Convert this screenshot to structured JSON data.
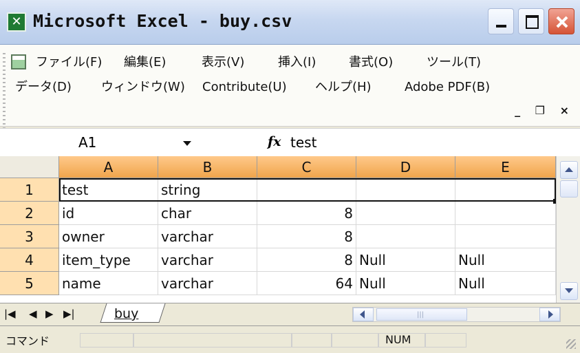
{
  "window": {
    "title": "Microsoft Excel - buy.csv",
    "app_icon_glyph": "✕"
  },
  "menu": {
    "row1": [
      "ファイル(F)",
      "編集(E)",
      "表示(V)",
      "挿入(I)",
      "書式(O)",
      "ツール(T)"
    ],
    "row2": [
      "データ(D)",
      "ウィンドウ(W)",
      "Contribute(U)",
      "ヘルプ(H)",
      "Adobe PDF(B)"
    ],
    "doc_controls": "_ ❐ ×"
  },
  "formula_bar": {
    "name_box": "A1",
    "fx_label": "fx",
    "value": "test"
  },
  "grid": {
    "columns": [
      "A",
      "B",
      "C",
      "D",
      "E"
    ],
    "rows": [
      {
        "num": "1",
        "cells": [
          "test",
          "string",
          "",
          "",
          ""
        ]
      },
      {
        "num": "2",
        "cells": [
          "id",
          "char",
          "8",
          "",
          ""
        ]
      },
      {
        "num": "3",
        "cells": [
          "owner",
          "varchar",
          "8",
          "",
          ""
        ]
      },
      {
        "num": "4",
        "cells": [
          "item_type",
          "varchar",
          "8",
          "Null",
          "Null"
        ]
      },
      {
        "num": "5",
        "cells": [
          "name",
          "varchar",
          "64",
          "Null",
          "Null"
        ]
      }
    ]
  },
  "sheets": {
    "nav": [
      "|◀",
      "◀",
      "▶",
      "▶|"
    ],
    "active": "buy"
  },
  "hscroll": {
    "grip": "|||"
  },
  "status": {
    "mode": "コマンド",
    "num": "NUM"
  },
  "colors": {
    "column_header": "#f0a54c",
    "row_header": "#ffe0b0",
    "close_button": "#d55436"
  }
}
